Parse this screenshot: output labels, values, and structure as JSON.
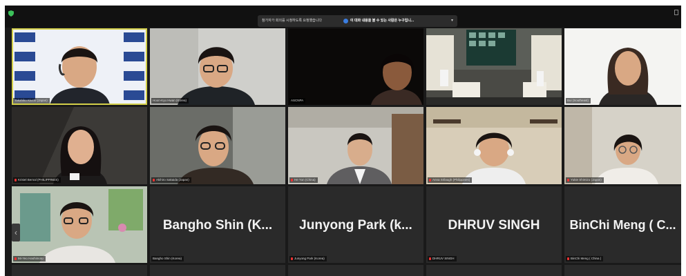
{
  "app": {
    "banner_text": "참가자가 회의를 시청하도록 요청했습니다",
    "banner_speaker": "이 대화 내용을 볼 수 있는 사람은 누구입니...",
    "banner_caret": "▾"
  },
  "tiles": [
    {
      "name": "Takahiko Kiuchi (Japan)",
      "type": "video",
      "active": true
    },
    {
      "name": "Hoon-Kyu Hwan (Korea)",
      "type": "video"
    },
    {
      "name": "ASCNPA",
      "type": "video"
    },
    {
      "name": "",
      "type": "video"
    },
    {
      "name": "Bui (Southeast)",
      "type": "video"
    },
    {
      "name": "Kristel Bernal (PHILIPPINES)",
      "type": "video"
    },
    {
      "name": "Akihiro Sakaida (Japan)",
      "type": "video"
    },
    {
      "name": "He Yun (China)",
      "type": "video"
    },
    {
      "name": "Anna Srilaugh (Philippines)",
      "type": "video"
    },
    {
      "name": "Yukie Shimizu (Japan)",
      "type": "video"
    },
    {
      "name": "Mi-Yeo Hashimoto",
      "type": "video"
    },
    {
      "name": "Bangho Shin (Korea)",
      "type": "name",
      "display": "Bangho Shin (K..."
    },
    {
      "name": "Junyong Park (Korea)",
      "type": "name",
      "display": "Junyong Park (k..."
    },
    {
      "name": "DHRUV SINGH",
      "type": "name",
      "display": "DHRUV SINGH"
    },
    {
      "name": "BinChi Meng ( China )",
      "type": "name",
      "display": "BinChi Meng ( C..."
    }
  ],
  "nav": {
    "prev_arrow": "‹"
  },
  "colors": {
    "active_speaker": "#d4d04a",
    "tile_bg": "#2a2a2a",
    "window_bg": "#1a1a1a",
    "mic_muted": "#e33"
  }
}
